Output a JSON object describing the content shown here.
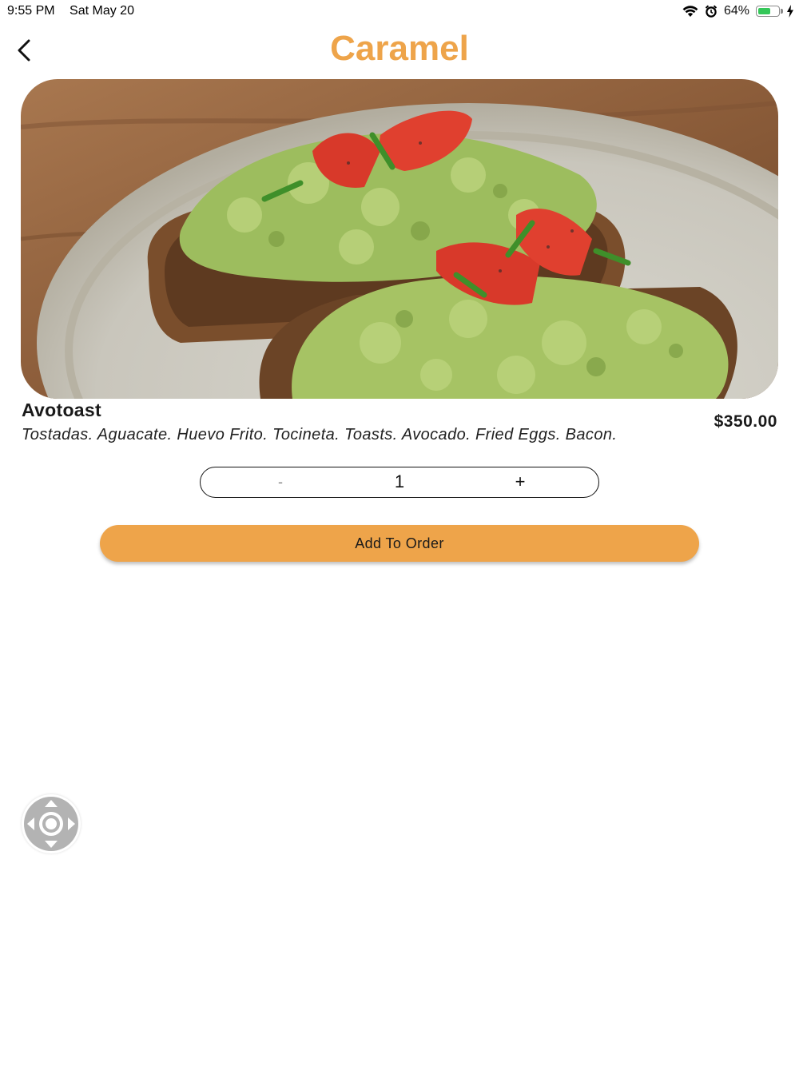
{
  "status_bar": {
    "time": "9:55 PM",
    "date": "Sat May 20",
    "battery_percent": "64%",
    "battery_level": 0.64
  },
  "header": {
    "title": "Caramel",
    "title_color": "#eea44a"
  },
  "product": {
    "image_icon": "avocado-toast-photo",
    "name": "Avotoast",
    "description": "Tostadas. Aguacate. Huevo Frito. Tocineta. Toasts. Avocado. Fried Eggs. Bacon.",
    "price": "$350.00"
  },
  "quantity": {
    "minus_label": "-",
    "value": "1",
    "plus_label": "+"
  },
  "actions": {
    "add_label": "Add To Order",
    "accent_color": "#eea44a"
  }
}
